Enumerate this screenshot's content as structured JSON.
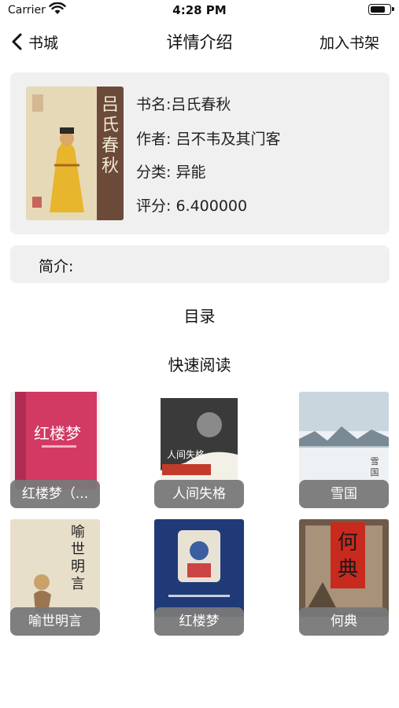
{
  "status_bar": {
    "carrier": "Carrier",
    "time": "4:28 PM",
    "battery_level": 0.8
  },
  "nav": {
    "back_label": "书城",
    "title": "详情介绍",
    "action_label": "加入书架"
  },
  "book": {
    "name_line": "书名:吕氏春秋",
    "author_line": "作者: 吕不韦及其门客",
    "category_line": "分类: 异能",
    "rating_line": "评分: 6.400000",
    "cover_text": "吕氏春秋"
  },
  "intro": {
    "label": "简介:"
  },
  "catalog_label": "目录",
  "quick_read_title": "快速阅读",
  "quick_books": [
    {
      "title": "红楼梦（...",
      "cover_text": "红楼梦"
    },
    {
      "title": "人间失格",
      "cover_text": "人间失格"
    },
    {
      "title": "雪国",
      "cover_text": "雪国"
    },
    {
      "title": "喻世明言",
      "cover_text": "喻世明言"
    },
    {
      "title": "红楼梦",
      "cover_text": ""
    },
    {
      "title": "何典",
      "cover_text": "何典"
    }
  ]
}
